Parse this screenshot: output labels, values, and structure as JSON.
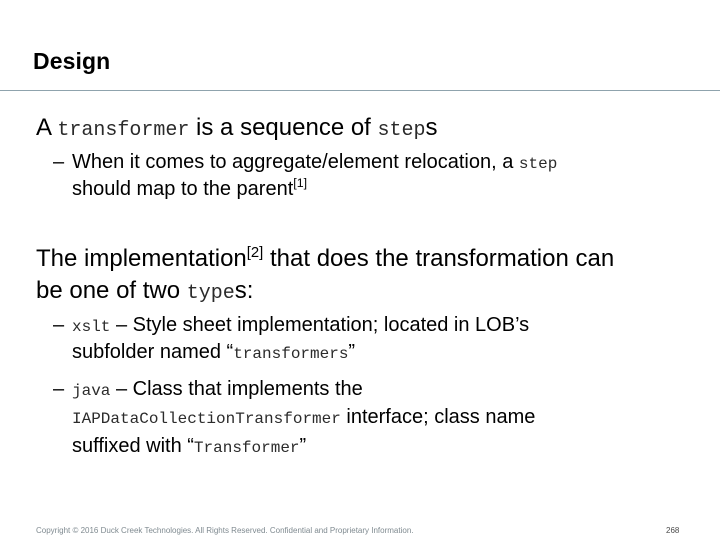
{
  "title": "Design",
  "bullet1": {
    "t1": "A ",
    "c1": "transformer",
    "t2": " is a sequence of ",
    "c2": "step",
    "t3": "s"
  },
  "sub1": {
    "dash": "–",
    "t1": "When it comes to aggregate/element relocation, a ",
    "c1": "step",
    "t2": "should map to the parent",
    "sup": "[1]"
  },
  "bullet2": {
    "t1": "The implementation",
    "sup": "[2]",
    "t2": " that does the transformation can",
    "t3": "be one of two ",
    "c1": "type",
    "t4": "s:"
  },
  "sub2": {
    "dash": "–",
    "c1": "xslt",
    "t1": " – Style sheet implementation; located in LOB’s",
    "t2": "subfolder named “",
    "c2": "transformers",
    "t3": "”"
  },
  "sub3": {
    "dash": "–",
    "c1": "java",
    "t1": " – Class that implements the",
    "c2": "IAPDataCollectionTransformer",
    "t2": " interface; class name",
    "t3": "suffixed with “",
    "c3": "Transformer",
    "t4": "”"
  },
  "footer": {
    "copyright": "Copyright © 2016 Duck Creek Technologies. All Rights Reserved. Confidential and Proprietary Information.",
    "page_number": "268"
  }
}
